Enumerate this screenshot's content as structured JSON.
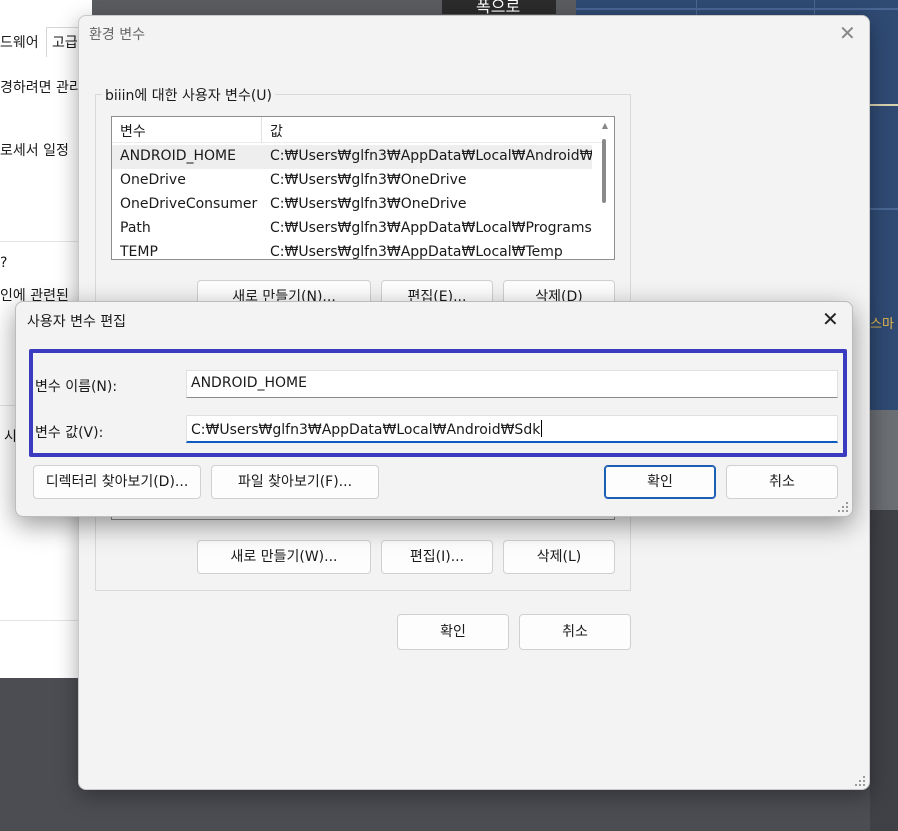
{
  "background": {
    "top_fragment": "폭으로",
    "left_fragments": [
      "드웨어",
      "고급",
      "경하려면 관리",
      "로세서 일정",
      "인에 관련된",
      "시"
    ],
    "right_fragment": "스마"
  },
  "env_window": {
    "title": "환경 변수",
    "user_group_label": "biiin에 대한 사용자 변수(U)",
    "columns": [
      "변수",
      "값"
    ],
    "user_vars": [
      {
        "name": "ANDROID_HOME",
        "value": "C:₩Users₩glfn3₩AppData₩Local₩Android₩Sdk"
      },
      {
        "name": "OneDrive",
        "value": "C:₩Users₩glfn3₩OneDrive"
      },
      {
        "name": "OneDriveConsumer",
        "value": "C:₩Users₩glfn3₩OneDrive"
      },
      {
        "name": "Path",
        "value": "C:₩Users₩glfn3₩AppData₩Local₩Programs₩..."
      },
      {
        "name": "TEMP",
        "value": "C:₩Users₩glfn3₩AppData₩Local₩Temp"
      }
    ],
    "user_buttons": {
      "new": "새로 만들기(N)...",
      "edit": "편집(E)...",
      "delete": "삭제(D)"
    },
    "system_buttons": {
      "new": "새로 만들기(W)...",
      "edit": "편집(I)...",
      "delete": "삭제(L)"
    },
    "ok": "확인",
    "cancel": "취소"
  },
  "edit_dialog": {
    "title": "사용자 변수 편집",
    "name_label": "변수 이름(N):",
    "name_value": "ANDROID_HOME",
    "value_label": "변수 값(V):",
    "value_value": "C:₩Users₩glfn3₩AppData₩Local₩Android₩Sdk",
    "browse_dir": "디렉터리 찾아보기(D)...",
    "browse_file": "파일 찾아보기(F)...",
    "ok": "확인",
    "cancel": "취소",
    "highlight_color": "#3b3bbf"
  },
  "icons": {
    "close": "close-icon",
    "resize": "resize-grip-icon"
  }
}
